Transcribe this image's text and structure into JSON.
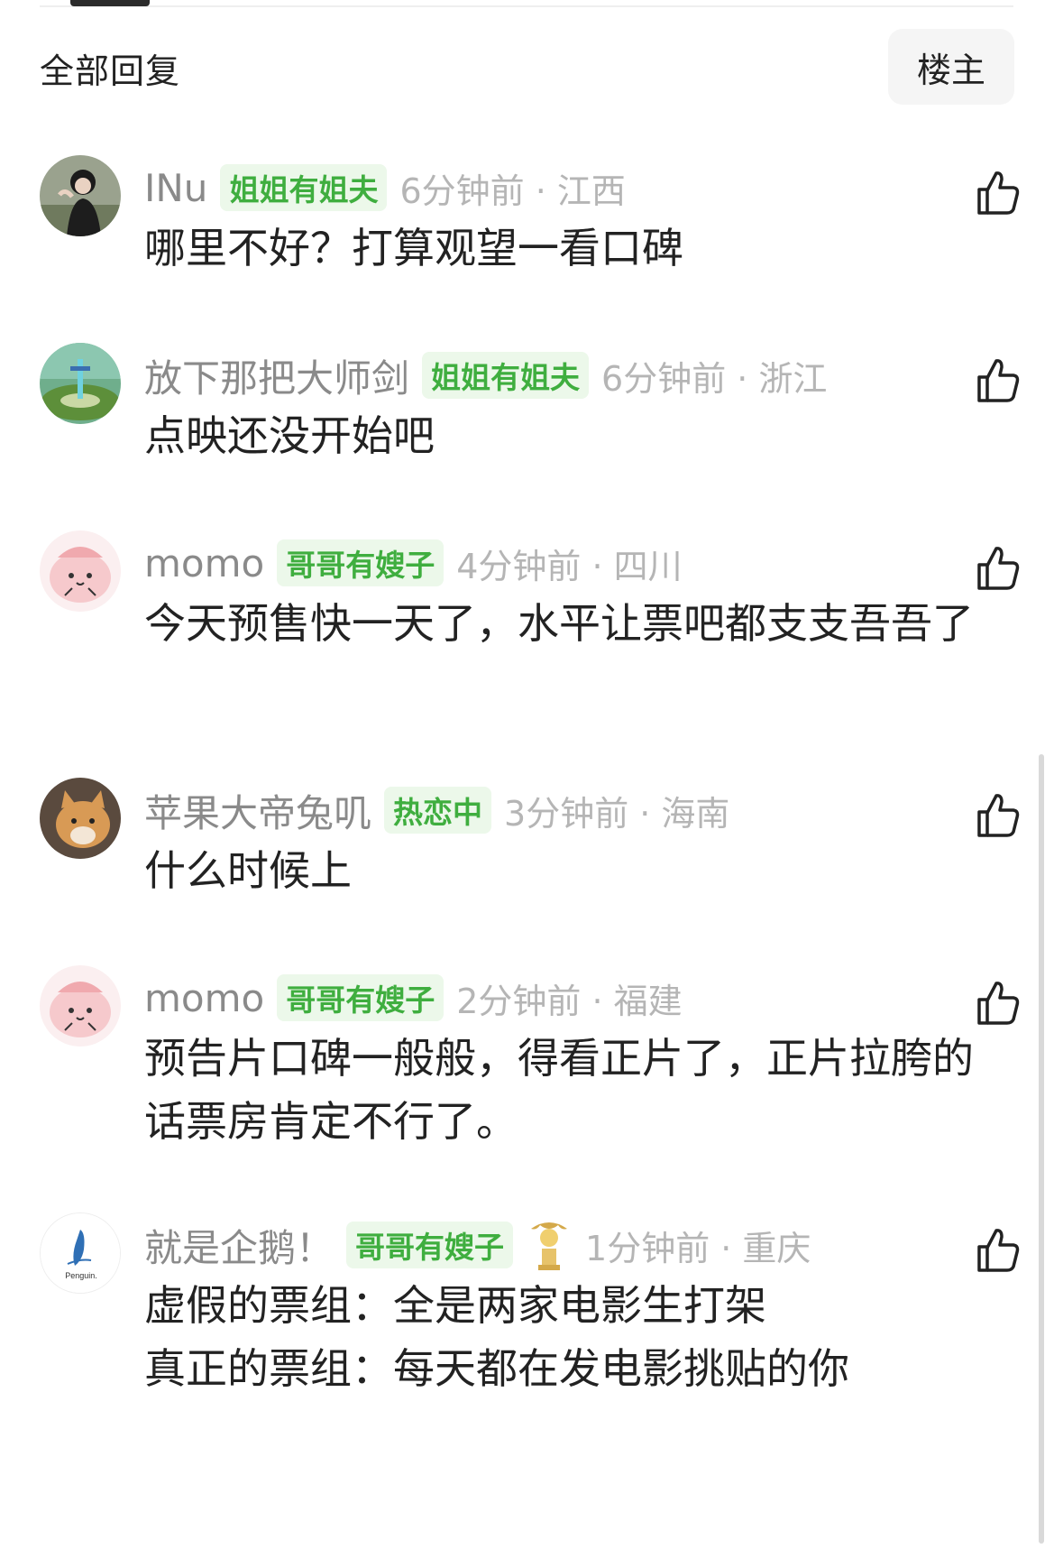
{
  "header": {
    "title": "全部回复",
    "owner_button": "楼主"
  },
  "comments": [
    {
      "username": "INu",
      "tag": "姐姐有姐夫",
      "time": "6分钟前 · 江西",
      "text": "哪里不好？打算观望一看口碑",
      "avatar_icon": "girl-photo-avatar"
    },
    {
      "username": "放下那把大师剑",
      "tag": "姐姐有姐夫",
      "time": "6分钟前 · 浙江",
      "text": "点映还没开始吧",
      "avatar_icon": "master-sword-avatar"
    },
    {
      "username": "momo",
      "tag": "哥哥有嫂子",
      "time": "4分钟前 · 四川",
      "text": "今天预售快一天了，水平让票吧都支支吾吾了",
      "avatar_icon": "pink-mascot-avatar"
    },
    {
      "username": "苹果大帝兔叽",
      "tag": "热恋中",
      "time": "3分钟前 · 海南",
      "text": "什么时候上",
      "avatar_icon": "cat-avatar"
    },
    {
      "username": "momo",
      "tag": "哥哥有嫂子",
      "time": "2分钟前 · 福建",
      "text": "预告片口碑一般般，得看正片了，正片拉胯的话票房肯定不行了。",
      "avatar_icon": "pink-mascot-avatar"
    },
    {
      "username": "就是企鹅！",
      "tag": "哥哥有嫂子",
      "time": "1分钟前 · 重庆",
      "text": "虚假的票组：全是两家电影生打架\n真正的票组：每天都在发电影挑贴的你",
      "avatar_icon": "penguin-avatar",
      "avatar_caption": "Penguin.",
      "has_medal": true
    }
  ],
  "colors": {
    "tag_text": "#3fae3f",
    "tag_bg": "#ecf8ea",
    "meta_gray": "#b5b5b5",
    "name_gray": "#8a8a8a"
  }
}
